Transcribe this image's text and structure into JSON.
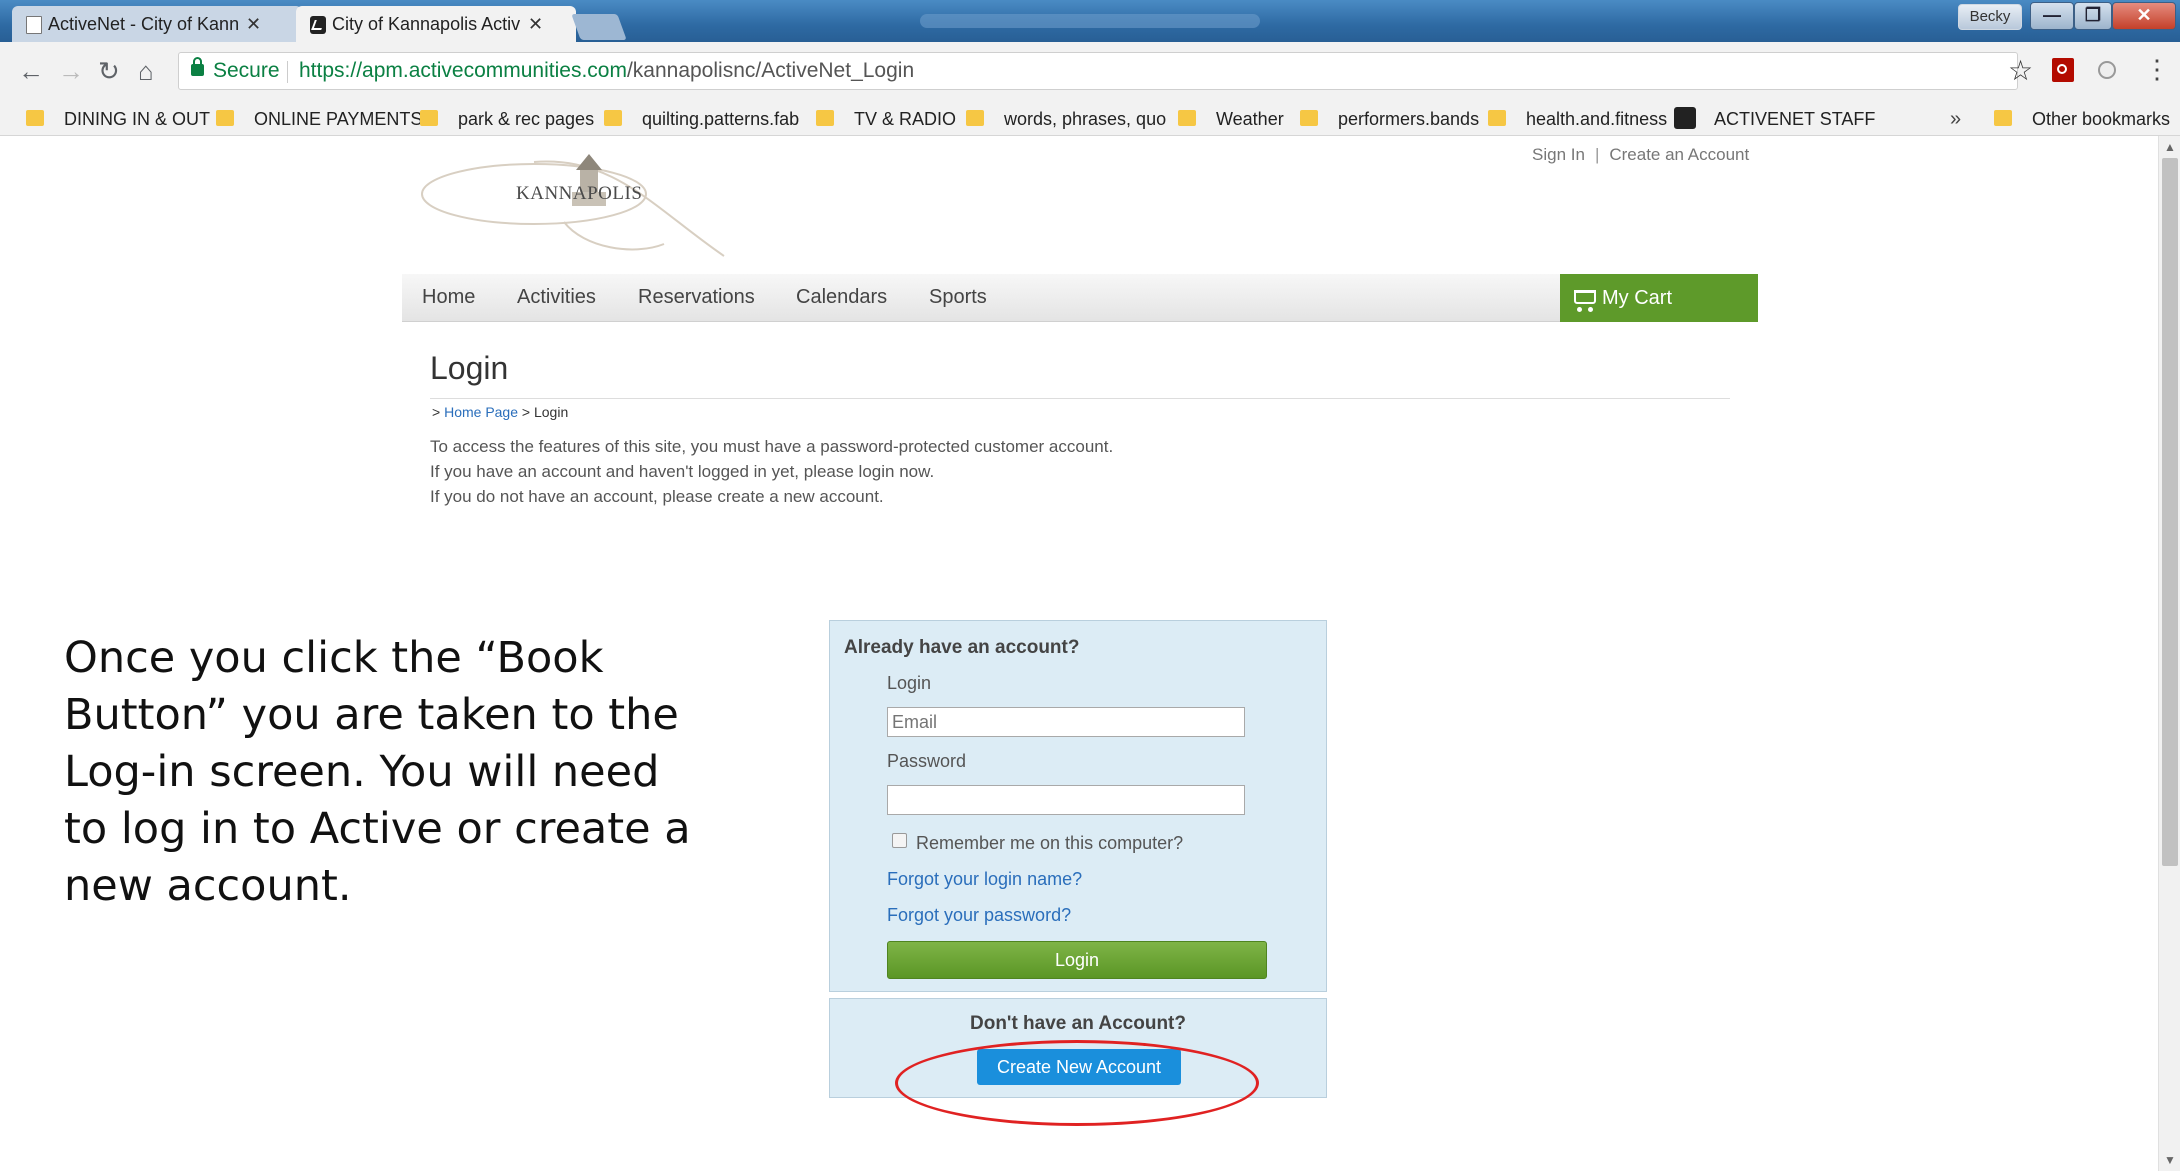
{
  "browser": {
    "tabs": [
      {
        "title": "ActiveNet - City of Kanna",
        "state": "inactive"
      },
      {
        "title": "City of Kannapolis Activit",
        "state": "active"
      }
    ],
    "user_label": "Becky",
    "secure_label": "Secure",
    "url_host": "https://apm.activecommunities.com",
    "url_path": "/kannapolisnc/ActiveNet_Login",
    "bookmarks": [
      "DINING IN & OUT",
      "ONLINE PAYMENTS",
      "park & rec pages",
      "quilting.patterns.fab",
      "TV & RADIO",
      "words, phrases, quo",
      "Weather",
      "performers.bands",
      "health.and.fitness",
      "ACTIVENET STAFF"
    ],
    "bookmarks_more": "»",
    "other_bookmarks": "Other bookmarks"
  },
  "site": {
    "logo_text": "KANNAPOLIS",
    "top_links": {
      "sign_in": "Sign In",
      "separator": "|",
      "create_account": "Create an Account"
    },
    "nav": [
      "Home",
      "Activities",
      "Reservations",
      "Calendars",
      "Sports"
    ],
    "cart_label": "My Cart"
  },
  "login_page": {
    "heading": "Login",
    "breadcrumb": {
      "prefix": ">",
      "home": "Home Page",
      "separator": ">",
      "current": "Login"
    },
    "intro": [
      "To access the features of this site, you must have a password-protected customer account.",
      "If you have an account and haven't logged in yet, please login now.",
      "If you do not have an account, please create a new account."
    ],
    "existing": {
      "heading": "Already have an account?",
      "login_label": "Login",
      "email_placeholder": "Email",
      "password_label": "Password",
      "remember_label": "Remember me on this computer?",
      "forgot_login": "Forgot your login name?",
      "forgot_password": "Forgot your password?",
      "login_button": "Login"
    },
    "new_account": {
      "heading": "Don't have an Account?",
      "button": "Create New Account"
    }
  },
  "caption": "Once you click the “Book Button”  you are taken to the Log-in screen.  You will need to log in to Active or create a new account.",
  "colors": {
    "cart_green": "#5e9a2a",
    "create_blue": "#1a8fdc",
    "annotation_red": "#e02222"
  }
}
